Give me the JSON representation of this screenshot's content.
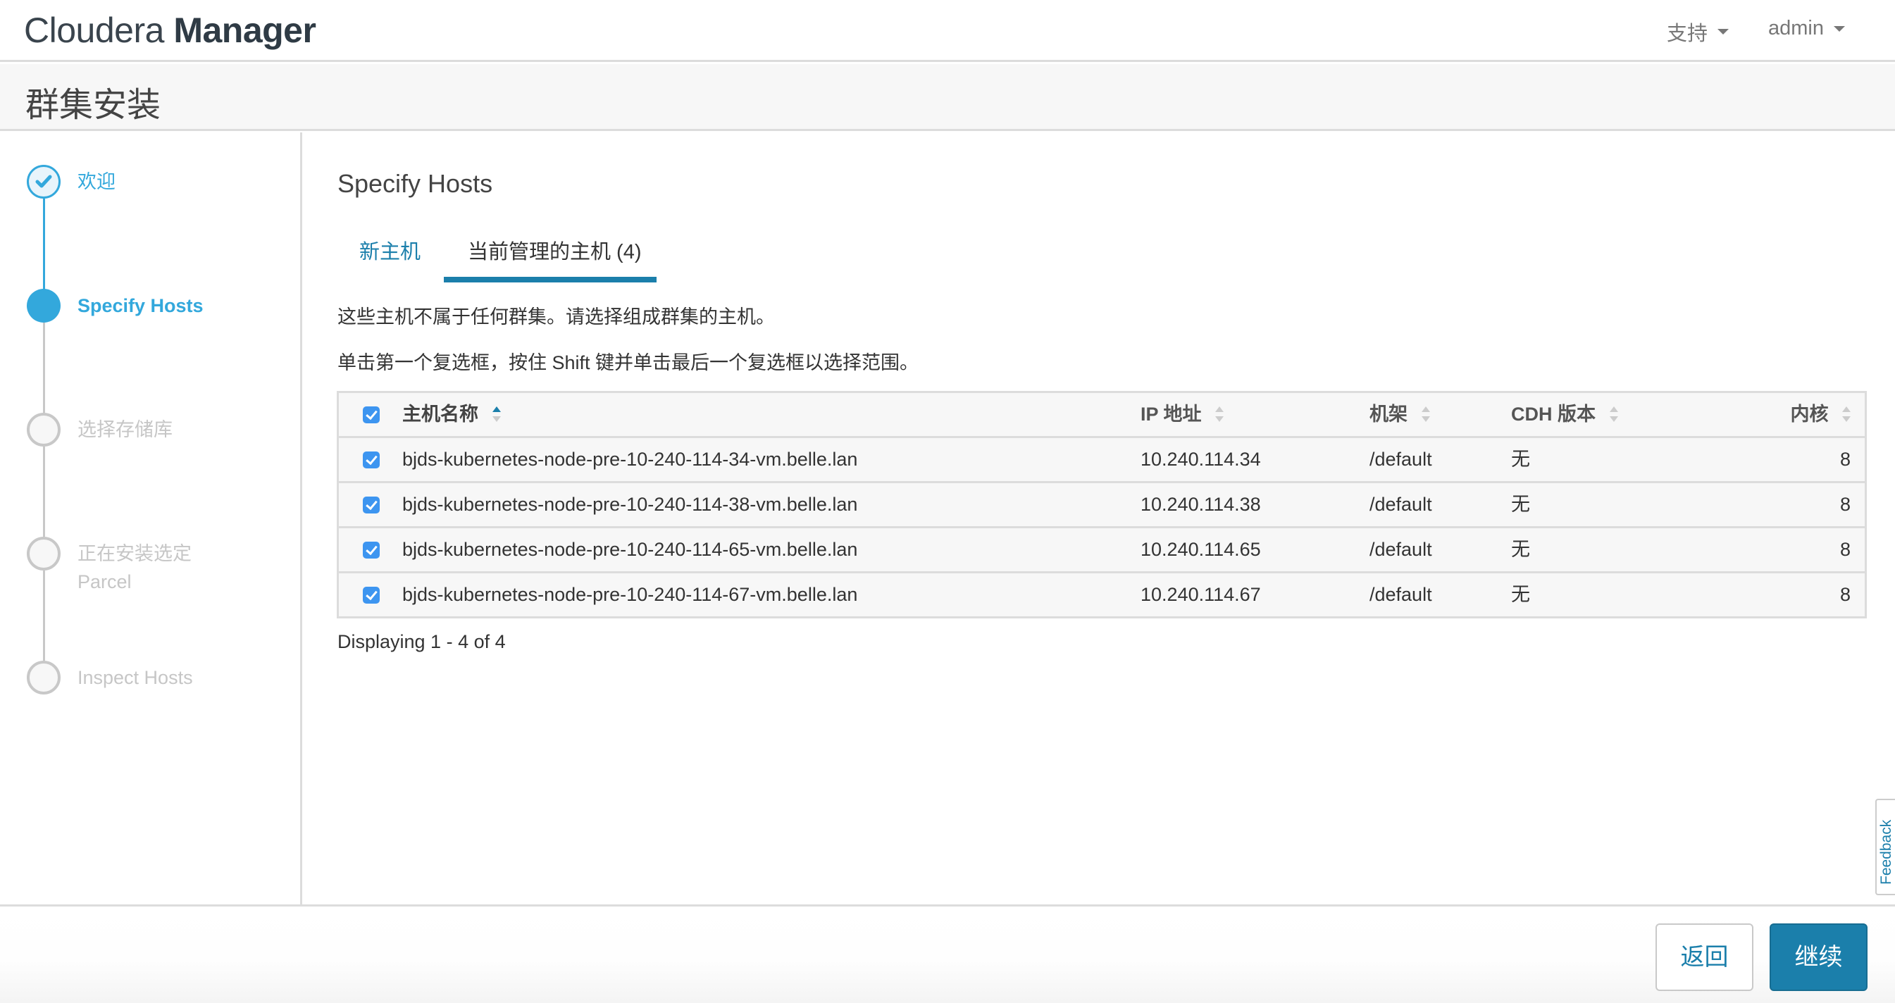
{
  "header": {
    "brand_light": "Cloudera",
    "brand_bold": "Manager",
    "support_label": "支持",
    "user_label": "admin"
  },
  "subheader": {
    "title": "群集安装"
  },
  "wizard": {
    "steps": [
      {
        "label": "欢迎",
        "state": "done"
      },
      {
        "label": "Specify Hosts",
        "state": "active"
      },
      {
        "label": "选择存储库",
        "state": "todo"
      },
      {
        "label_line1": "正在安装选定",
        "label_line2": "Parcel",
        "state": "todo"
      },
      {
        "label": "Inspect Hosts",
        "state": "todo"
      }
    ]
  },
  "main": {
    "title": "Specify Hosts",
    "tabs": [
      {
        "label": "新主机",
        "active": false
      },
      {
        "label": "当前管理的主机 (4)",
        "active": true
      }
    ],
    "description": "这些主机不属于任何群集。请选择组成群集的主机。",
    "hint": "单击第一个复选框，按住 Shift 键并单击最后一个复选框以选择范围。",
    "table": {
      "columns": {
        "name": "主机名称",
        "ip": "IP 地址",
        "rack": "机架",
        "cdh": "CDH 版本",
        "cores": "内核"
      },
      "sorted_column": "name",
      "sort_direction": "asc",
      "all_selected": true,
      "rows": [
        {
          "selected": true,
          "name": "bjds-kubernetes-node-pre-10-240-114-34-vm.belle.lan",
          "ip": "10.240.114.34",
          "rack": "/default",
          "cdh": "无",
          "cores": "8"
        },
        {
          "selected": true,
          "name": "bjds-kubernetes-node-pre-10-240-114-38-vm.belle.lan",
          "ip": "10.240.114.38",
          "rack": "/default",
          "cdh": "无",
          "cores": "8"
        },
        {
          "selected": true,
          "name": "bjds-kubernetes-node-pre-10-240-114-65-vm.belle.lan",
          "ip": "10.240.114.65",
          "rack": "/default",
          "cdh": "无",
          "cores": "8"
        },
        {
          "selected": true,
          "name": "bjds-kubernetes-node-pre-10-240-114-67-vm.belle.lan",
          "ip": "10.240.114.67",
          "rack": "/default",
          "cdh": "无",
          "cores": "8"
        }
      ]
    },
    "pagination_text": "Displaying 1 - 4 of 4"
  },
  "feedback_label": "Feedback",
  "footer": {
    "back_label": "返回",
    "continue_label": "继续"
  },
  "colors": {
    "accent": "#33a8dc",
    "primary_button": "#1b7fab",
    "checkbox": "#3d95f0",
    "inactive_step": "#c6c6c6"
  }
}
